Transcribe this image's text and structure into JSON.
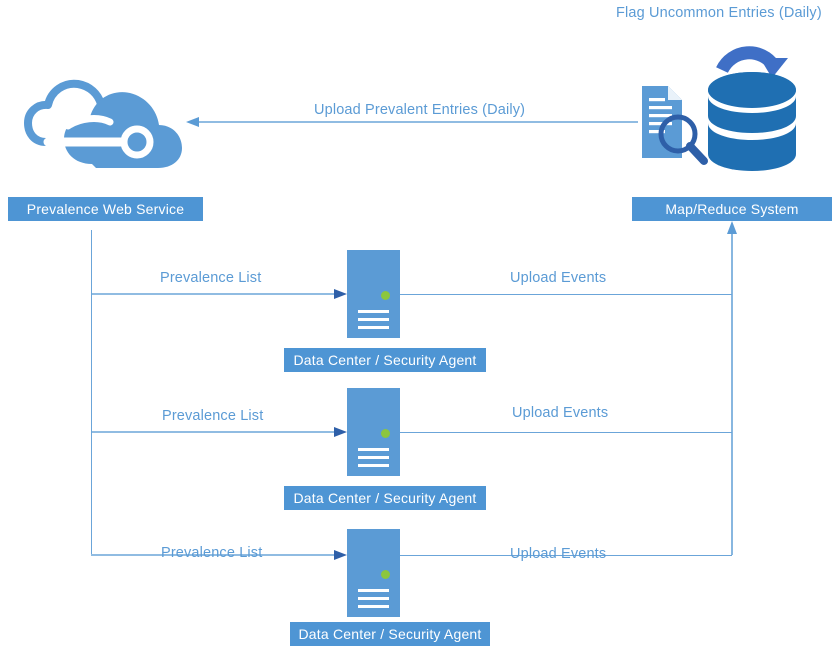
{
  "diagram": {
    "title_top": "Flag Uncommon Entries (Daily)",
    "colors": {
      "accent_light": "#5B9BD5",
      "accent_bar": "#4E95D4",
      "accent_dark": "#1F6FB2",
      "arrow_blue": "#3F6FC6",
      "line": "#6BA5D9",
      "status_dot": "#8CC63E",
      "text_on_bar": "#FFFFFF"
    },
    "nodes": {
      "web_service": {
        "label": "Prevalence Web Service",
        "icon": "cloud-icon"
      },
      "map_reduce": {
        "label": "Map/Reduce System",
        "icon": "database-icon"
      },
      "search_icon": "document-search-icon",
      "refresh_icon": "circular-arrow-icon"
    },
    "edges": {
      "upload_prevalent": "Upload Prevalent Entries (Daily)",
      "prevalence_list": "Prevalence List",
      "upload_events": "Upload Events"
    },
    "agents": [
      {
        "label": "Data Center / Security Agent",
        "in_label": "Prevalence List",
        "out_label": "Upload Events"
      },
      {
        "label": "Data Center / Security Agent",
        "in_label": "Prevalence List",
        "out_label": "Upload Events"
      },
      {
        "label": "Data Center / Security Agent",
        "in_label": "Prevalence List",
        "out_label": "Upload Events"
      }
    ]
  }
}
